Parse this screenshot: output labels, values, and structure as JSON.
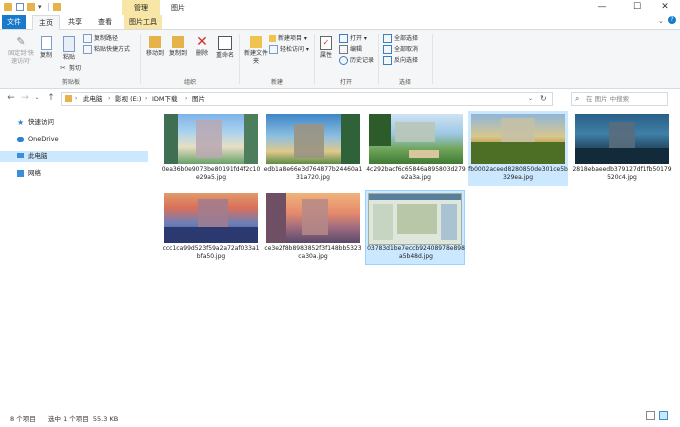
{
  "window": {
    "title": "图片",
    "contextual_tab_group": "管理",
    "controls": {
      "minimize": "—",
      "maximize": "☐",
      "close": "✕"
    }
  },
  "tabs": {
    "file": "文件",
    "home": "主页",
    "share": "共享",
    "view": "查看",
    "picture_tools": "图片工具"
  },
  "ribbon": {
    "clipboard": {
      "label": "剪贴板",
      "pin": "固定到'快速访问'",
      "copy": "复制",
      "paste": "粘贴",
      "copy_path": "复制路径",
      "paste_shortcut": "粘贴快捷方式",
      "cut": "剪切"
    },
    "organize": {
      "label": "组织",
      "move_to": "移动到",
      "copy_to": "复制到",
      "delete": "删除",
      "rename": "重命名"
    },
    "new": {
      "label": "新建",
      "new_folder": "新建文件夹",
      "new_item": "新建项目",
      "easy_access": "轻松访问"
    },
    "open": {
      "label": "打开",
      "properties": "属性",
      "open": "打开",
      "edit": "编辑",
      "history": "历史记录"
    },
    "select": {
      "label": "选择",
      "select_all": "全部选择",
      "select_none": "全部取消",
      "invert": "反向选择"
    }
  },
  "address": {
    "back": "←",
    "forward": "→",
    "up": "↑",
    "crumbs": [
      "此电脑",
      "影视 (E:)",
      "IDM下载",
      "图片"
    ],
    "refresh": "↻",
    "search_placeholder": "在 图片 中搜索"
  },
  "nav_pane": {
    "items": [
      {
        "label": "快速访问",
        "icon": "star-icon"
      },
      {
        "label": "OneDrive",
        "icon": "cloud-icon"
      },
      {
        "label": "此电脑",
        "icon": "computer-icon"
      },
      {
        "label": "网络",
        "icon": "network-icon"
      }
    ]
  },
  "files": [
    {
      "name": "0ea36b0e9073be80191fd4f2c10e29a5.jpg",
      "selected": false
    },
    {
      "name": "edb1a8e66e3d764877b24460a131a720.jpg",
      "selected": false
    },
    {
      "name": "4c292bacf6c65846a895803d279e2a3a.jpg",
      "selected": false
    },
    {
      "name": "fb0002aceed8280850de301ce5b329ea.jpg",
      "selected": true
    },
    {
      "name": "2818ebaeedb379127df1fb50179520c4.jpg",
      "selected": false
    },
    {
      "name": "ccc1ca99d523f59a2a72af033a1bfa50.jpg",
      "selected": false
    },
    {
      "name": "ce3e2f8b8983852f3f148bb5323ca30a.jpg",
      "selected": false
    },
    {
      "name": "03783d1be7eccb92408978e898a5b48d.jpg",
      "selected": true
    }
  ],
  "status": {
    "count": "8 个项目",
    "selection": "选中 1 个项目  55.3 KB"
  },
  "colors": {
    "accent": "#1979ca",
    "selection": "#cce8ff",
    "manage_tab": "#f7e6a6"
  }
}
